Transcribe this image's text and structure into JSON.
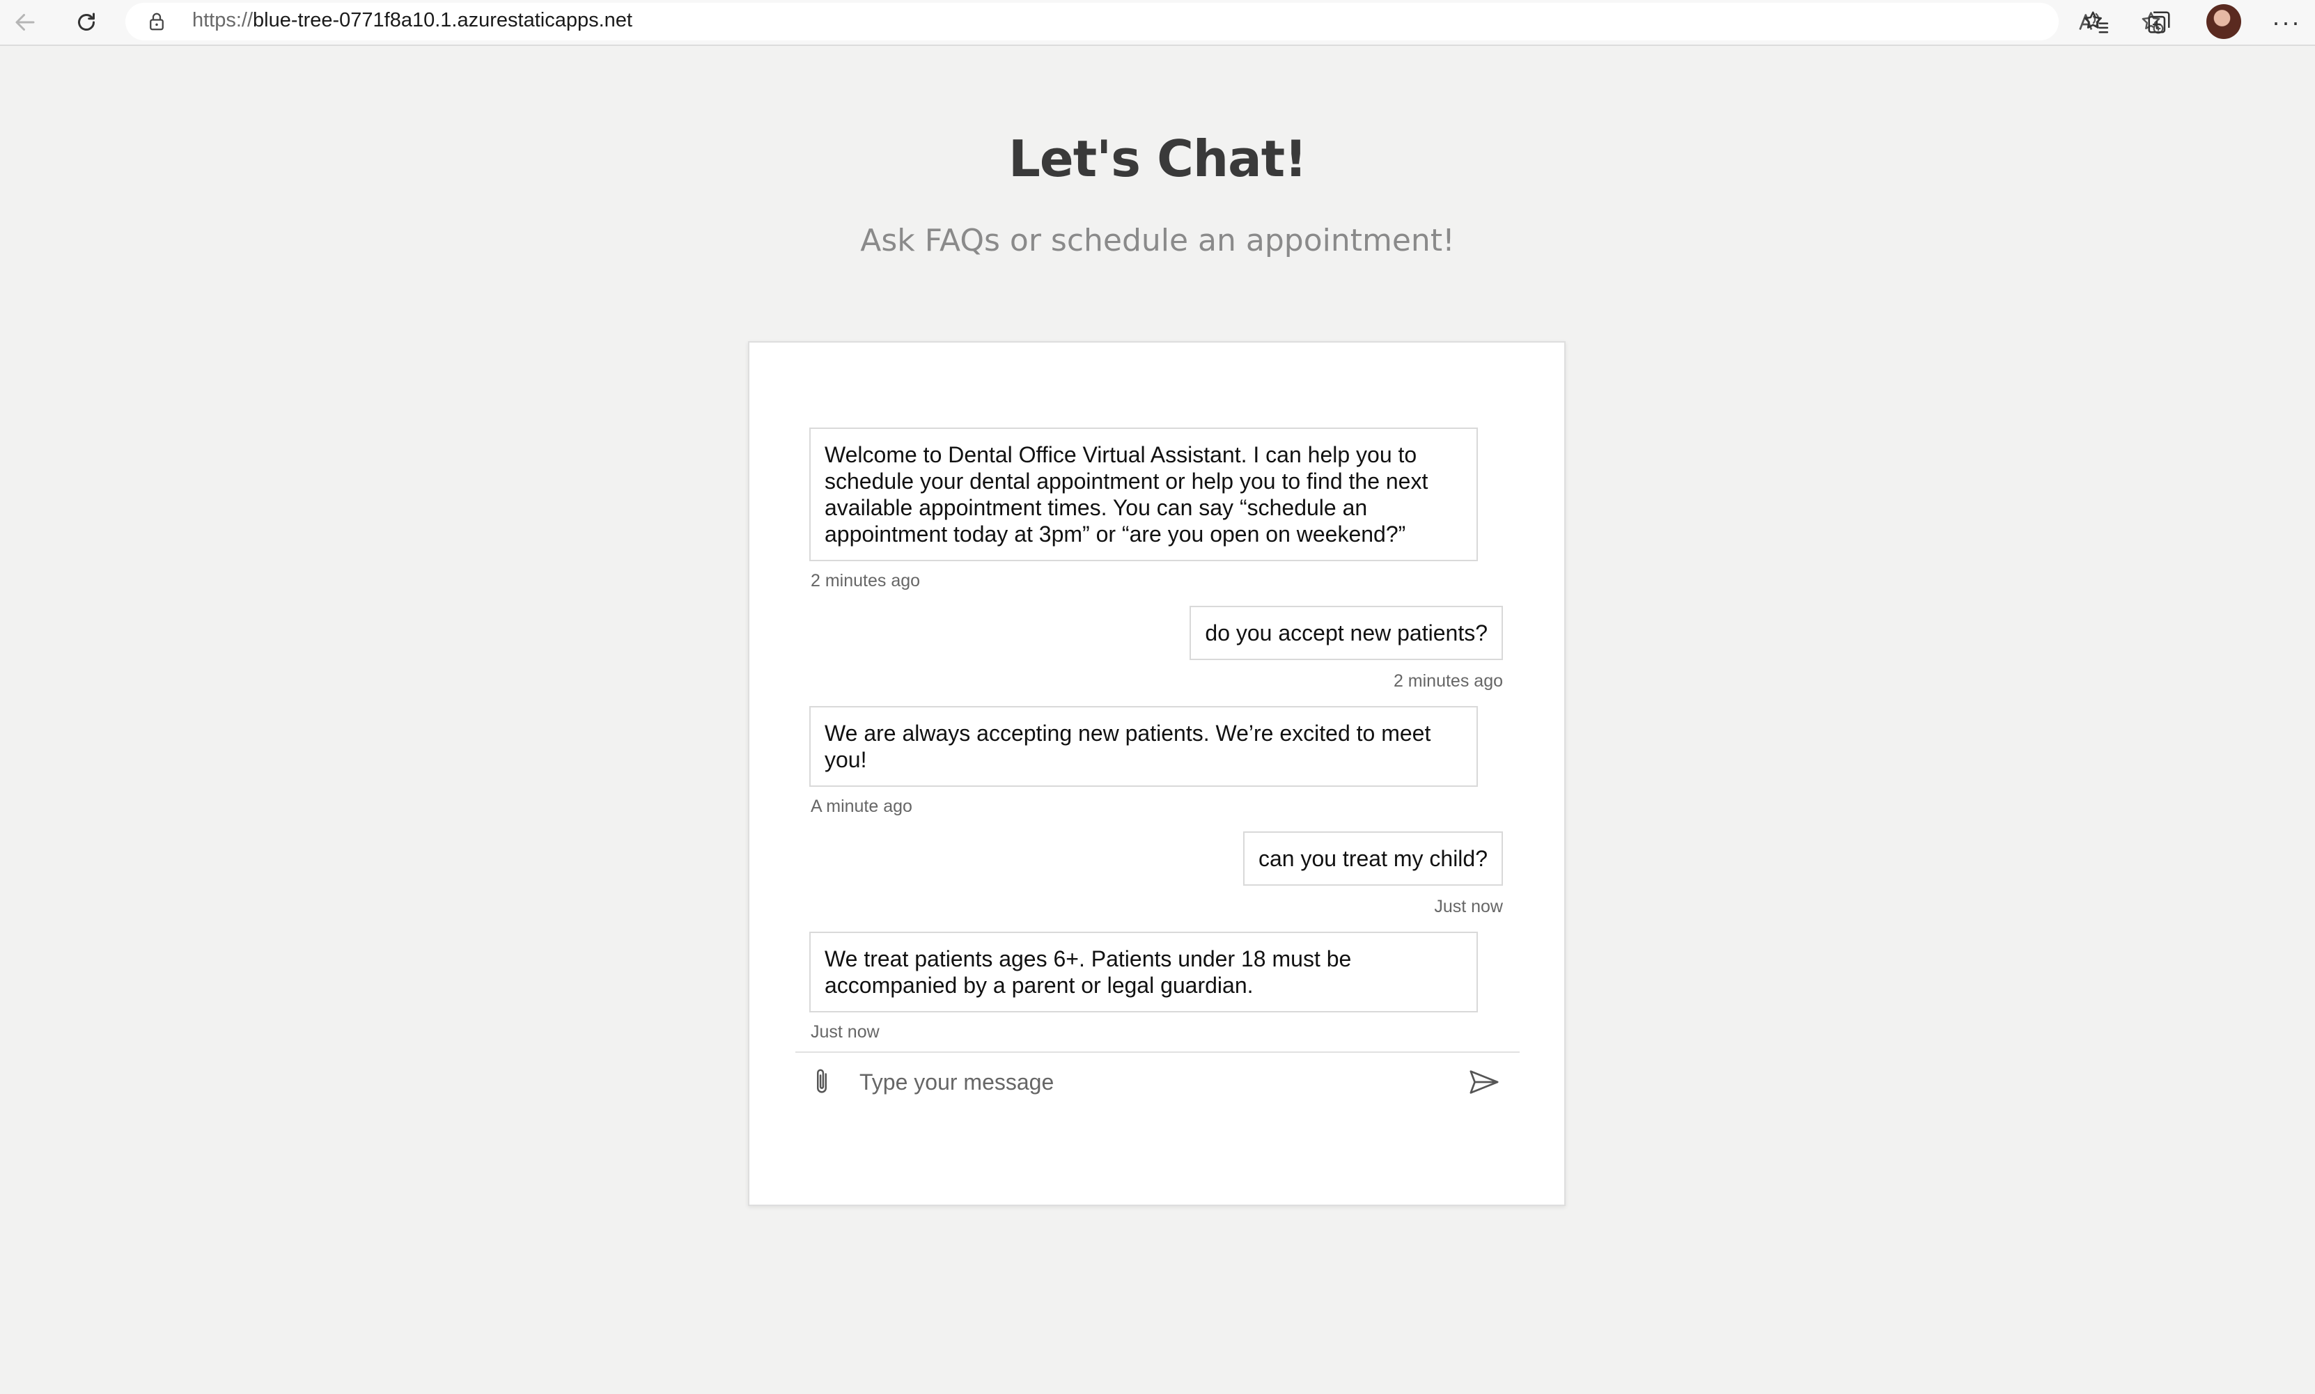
{
  "browser": {
    "url_protocol": "https://",
    "url_host": "blue-tree-0771f8a10.1.azurestaticapps.net",
    "icons": {
      "back": "back-arrow-icon",
      "reload": "reload-icon",
      "lock": "lock-icon",
      "read_aloud": "read-aloud-icon",
      "add_favorite": "add-favorite-icon",
      "favorites": "favorites-icon",
      "collections": "collections-icon",
      "more": "more-icon"
    },
    "more_glyph": "···"
  },
  "page": {
    "title": "Let's Chat!",
    "subtitle": "Ask FAQs or schedule an appointment!"
  },
  "chat": {
    "messages": [
      {
        "sender": "bot",
        "text": "Welcome to Dental Office Virtual Assistant. I can help you to schedule your dental appointment or help you to find the next available appointment times. You can say “schedule an appointment today at 3pm” or “are you open on weekend?”",
        "time": "2 minutes ago"
      },
      {
        "sender": "user",
        "text": "do you accept new patients?",
        "time": "2 minutes ago"
      },
      {
        "sender": "bot",
        "text": "We are always accepting new patients. We’re excited to meet you!",
        "time": "A minute ago"
      },
      {
        "sender": "user",
        "text": "can you treat my child?",
        "time": "Just now"
      },
      {
        "sender": "bot",
        "text": "We treat patients ages 6+. Patients under 18 must be accompanied by a parent or legal guardian.",
        "time": "Just now"
      }
    ],
    "composer": {
      "placeholder": "Type your message",
      "value": "",
      "attach_icon": "paperclip-icon",
      "send_icon": "send-icon"
    }
  },
  "colors": {
    "page_background": "#f2f2f1",
    "title": "#3a3a3a",
    "subtitle": "#8a8a8a",
    "bubble_border": "#d9d9d9",
    "timestamp": "#666666"
  }
}
